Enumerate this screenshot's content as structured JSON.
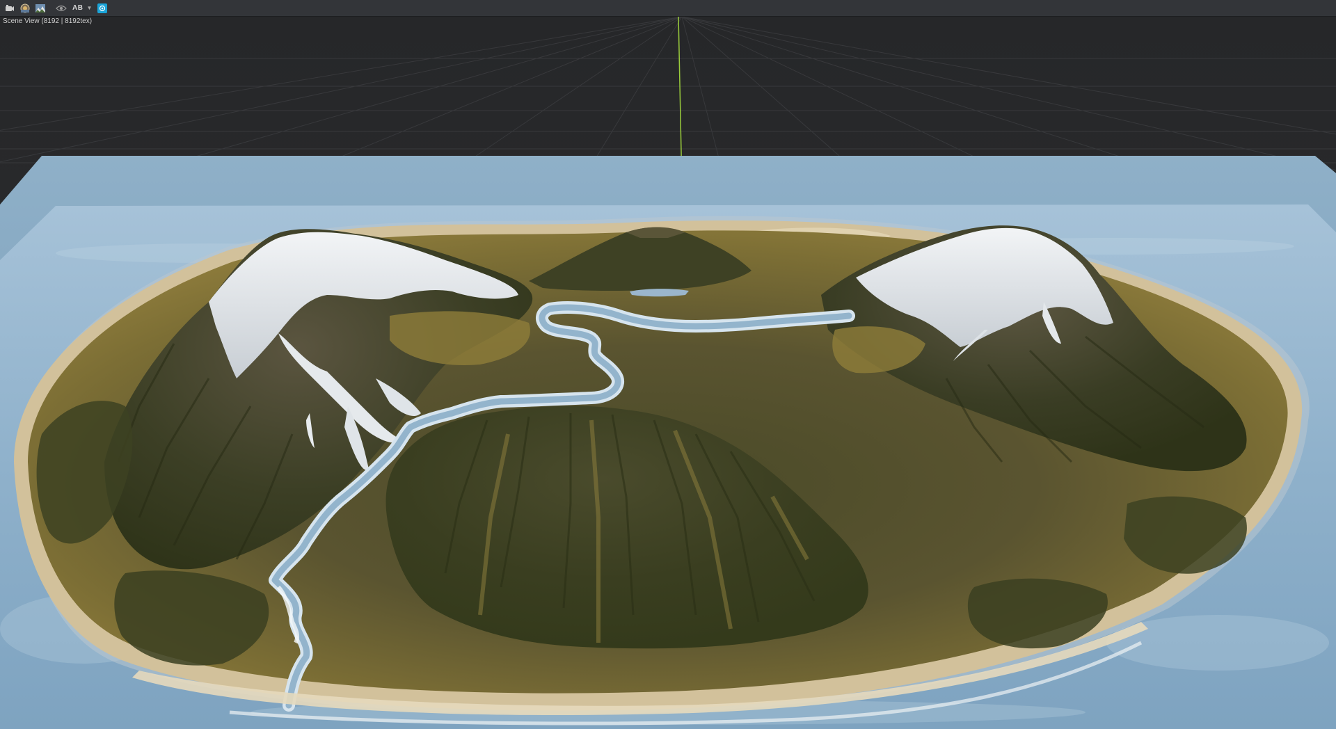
{
  "toolbar": {
    "buttons": [
      {
        "icon": "camera-view-icon"
      },
      {
        "icon": "render-settings-icon"
      },
      {
        "icon": "landscape-preview-icon"
      }
    ],
    "visibility_icon": "eye-icon",
    "ab_label": "AB",
    "ab_dropdown_icon": "chevron-down-icon",
    "active_toggle_icon": "target-icon"
  },
  "viewport": {
    "label": "Scene View (8192 | 8192tex)"
  },
  "colors": {
    "toolbar_bg": "#333539",
    "viewport_bg": "#2a2b2d",
    "grid_line": "#3a3b3d",
    "water": "#8fb3cf",
    "sand": "#cdbb95",
    "grassland": "#8a7a3a",
    "forest": "#3d4322",
    "rock": "#4a4636",
    "snow": "#e9ecef",
    "river": "#a8c7de",
    "axis_green": "#9acc3c",
    "accent": "#1aa4d8"
  }
}
